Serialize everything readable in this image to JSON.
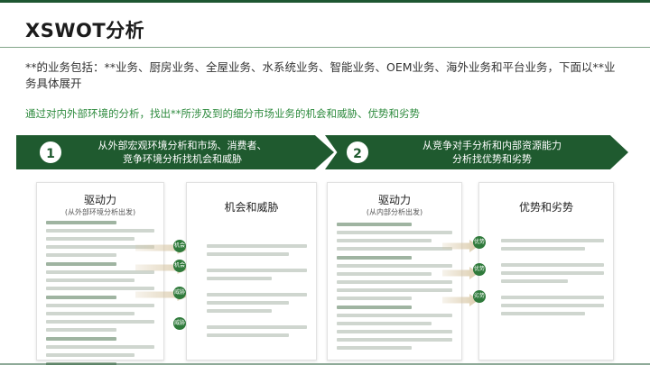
{
  "title": "XSWOT分析",
  "intro": "**的业务包括：**业务、厨房业务、全屋业务、水系统业务、智能业务、OEM业务、海外业务和平台业务，下面以**业务具体展开",
  "subhead": "通过对内外部环境的分析，找出**所涉及到的细分市场业务的机会和威胁、优势和劣势",
  "steps": [
    {
      "number": "1",
      "line1": "从外部宏观环境分析和市场、消费者、",
      "line2": "竞争环境分析找机会和威胁"
    },
    {
      "number": "2",
      "line1": "从竞争对手分析和内部资源能力",
      "line2": "分析找优势和劣势"
    }
  ],
  "cards": {
    "external_drivers": {
      "title": "驱动力",
      "subtitle": "(从外部环境分析出发)"
    },
    "opportunities_threats": {
      "title": "机会和威胁"
    },
    "internal_drivers": {
      "title": "驱动力",
      "subtitle": "(从内部分析出发)"
    },
    "strengths_weaknesses": {
      "title": "优势和劣势"
    }
  },
  "tags": {
    "opportunity": "机会",
    "threat": "威胁",
    "strength": "优势",
    "weakness": "劣势"
  }
}
